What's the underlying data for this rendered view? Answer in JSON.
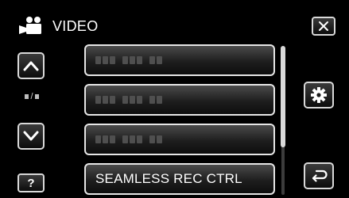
{
  "header": {
    "icon": "video-camera-icon",
    "title": "VIDEO"
  },
  "nav": {
    "page_indicator": "▪/▪",
    "help_label": "?"
  },
  "menu": {
    "items": [
      {
        "label": "",
        "placeholder": true
      },
      {
        "label": "",
        "placeholder": true
      },
      {
        "label": "",
        "placeholder": true
      },
      {
        "label": "SEAMLESS REC CTRL",
        "placeholder": false
      }
    ]
  },
  "scrollbar": {
    "position_fraction": 0.0,
    "visible_fraction": 0.68
  },
  "icons": {
    "close": "close-icon",
    "up": "chevron-up-icon",
    "down": "chevron-down-icon",
    "settings": "gear-icon",
    "back": "return-arrow-icon"
  }
}
